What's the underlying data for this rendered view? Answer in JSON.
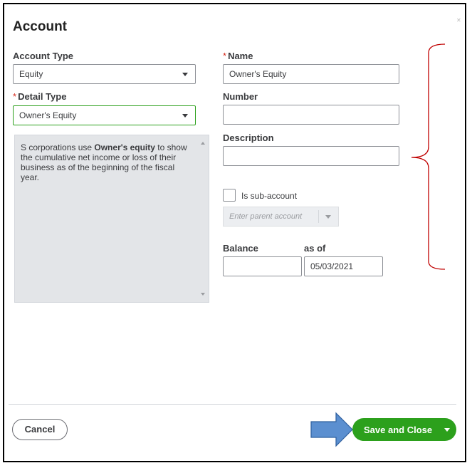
{
  "dialog": {
    "title": "Account"
  },
  "account_type": {
    "label": "Account Type",
    "value": "Equity"
  },
  "detail_type": {
    "label": "Detail Type",
    "value": "Owner's Equity"
  },
  "detail_description": {
    "prefix": "S corporations use ",
    "bold": "Owner's equity",
    "suffix": " to show the cumulative net income or loss of their business as of the beginning of the fiscal year."
  },
  "name": {
    "label": "Name",
    "value": "Owner's Equity"
  },
  "number": {
    "label": "Number",
    "value": ""
  },
  "description": {
    "label": "Description",
    "value": ""
  },
  "sub_account": {
    "label": "Is sub-account",
    "checked": false,
    "parent_placeholder": "Enter parent account"
  },
  "balance": {
    "label": "Balance",
    "value": ""
  },
  "as_of": {
    "label": "as of",
    "value": "05/03/2021"
  },
  "footer": {
    "cancel_label": "Cancel",
    "save_label": "Save and Close"
  },
  "colors": {
    "primary_green": "#2ca01c",
    "required_red": "#d52b1e",
    "annotation_red": "#c00000",
    "arrow_blue": "#5b8fd0"
  }
}
